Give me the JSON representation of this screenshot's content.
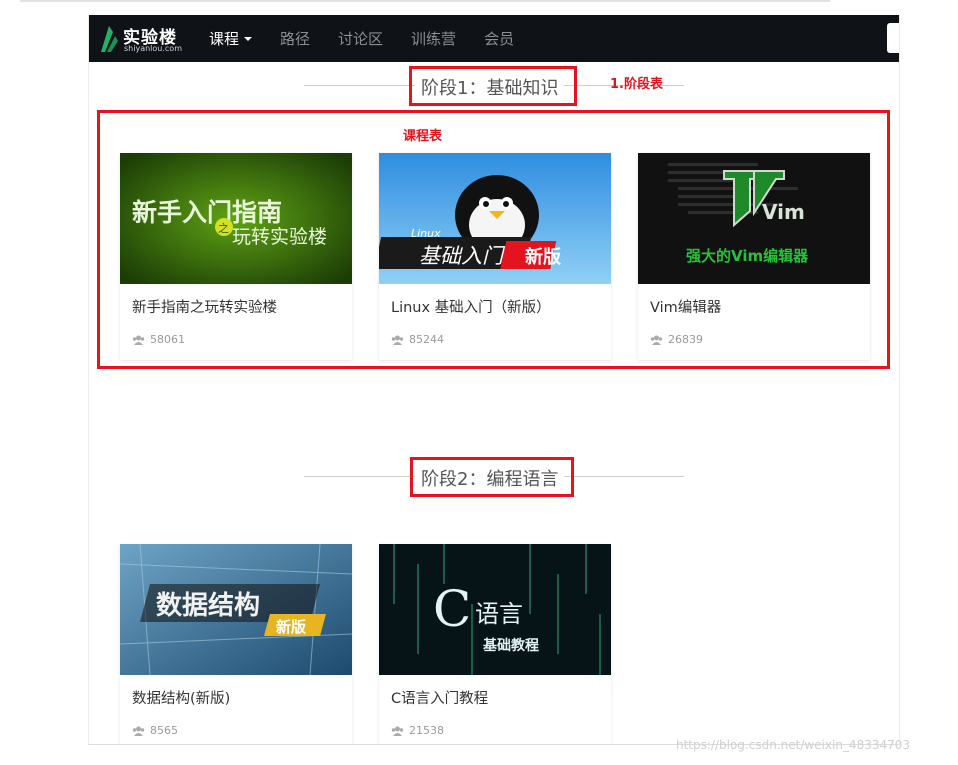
{
  "header": {
    "brand": "实验楼",
    "domain": "shiyanlou.com",
    "nav": [
      {
        "label": "课程",
        "active": true,
        "has_caret": true
      },
      {
        "label": "路径",
        "active": false
      },
      {
        "label": "讨论区",
        "active": false
      },
      {
        "label": "训练营",
        "active": false
      },
      {
        "label": "会员",
        "active": false
      }
    ]
  },
  "annotations": {
    "stage_table_label": "1.阶段表",
    "course_table_label": "课程表"
  },
  "stages": [
    {
      "title": "阶段1：基础知识",
      "courses": [
        {
          "title": "新手指南之玩转实验楼",
          "count": "58061",
          "thumb_text_1": "新手入门指南",
          "thumb_text_2": "之",
          "thumb_text_3": "玩转实验楼"
        },
        {
          "title": "Linux 基础入门（新版）",
          "count": "85244",
          "thumb_text_1": "Linux",
          "thumb_text_2": "基础入门",
          "thumb_text_3": "新版"
        },
        {
          "title": "Vim编辑器",
          "count": "26839",
          "thumb_text_1": "Vim",
          "thumb_text_2": "强大的Vim编辑器"
        }
      ]
    },
    {
      "title": "阶段2：编程语言",
      "courses": [
        {
          "title": "数据结构(新版)",
          "count": "8565",
          "thumb_text_1": "数据结构",
          "thumb_text_2": "新版"
        },
        {
          "title": "C语言入门教程",
          "count": "21538",
          "thumb_text_1": "C",
          "thumb_text_2": "语言",
          "thumb_text_3": "基础教程"
        }
      ]
    }
  ],
  "watermark": "https://blog.csdn.net/weixin_48334703",
  "colors": {
    "navbar": "#0f1216",
    "annotation_red": "#e3141d",
    "brand_green": "#23b06a"
  }
}
